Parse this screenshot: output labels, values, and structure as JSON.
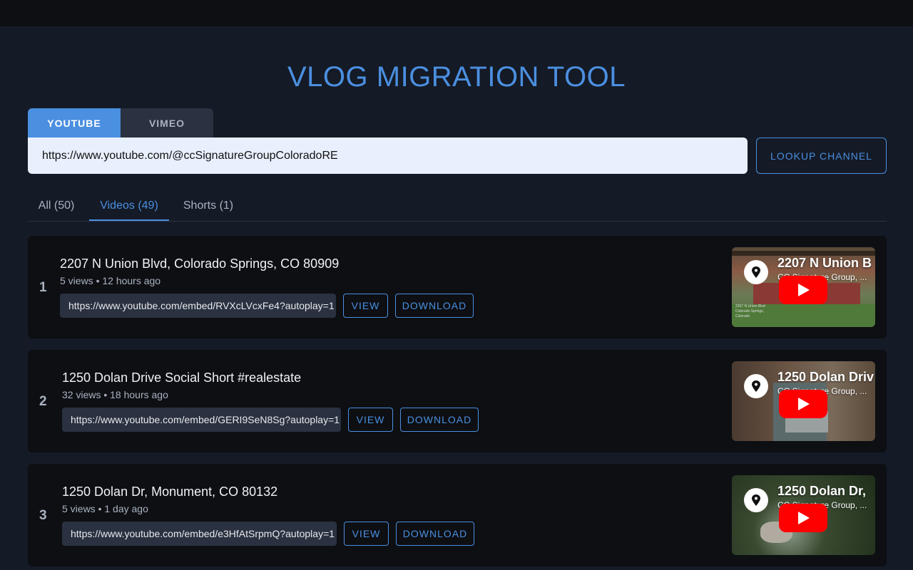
{
  "page": {
    "title": "VLOG MIGRATION TOOL"
  },
  "source_tabs": [
    {
      "label": "YOUTUBE",
      "active": true
    },
    {
      "label": "VIMEO",
      "active": false
    }
  ],
  "channel_input": {
    "value": "https://www.youtube.com/@ccSignatureGroupColoradoRE"
  },
  "lookup_button": {
    "label": "LOOKUP CHANNEL"
  },
  "filter_tabs": [
    {
      "label": "All (50)",
      "active": false
    },
    {
      "label": "Videos (49)",
      "active": true
    },
    {
      "label": "Shorts (1)",
      "active": false
    }
  ],
  "videos": [
    {
      "index": "1",
      "title": "2207 N Union Blvd, Colorado Springs, CO 80909",
      "meta": "5 views • 12 hours ago",
      "embed_url": "https://www.youtube.com/embed/RVXcLVcxFe4?autoplay=1",
      "view_label": "VIEW",
      "download_label": "DOWNLOAD",
      "thumb_title": "2207 N Union B",
      "thumb_channel": "CC Signature Group, ...",
      "thumb_caption": "2207 N Union Blvd Colorado Springs, Colorado"
    },
    {
      "index": "2",
      "title": "1250 Dolan Drive Social Short #realestate",
      "meta": "32 views • 18 hours ago",
      "embed_url": "https://www.youtube.com/embed/GERI9SeN8Sg?autoplay=1",
      "view_label": "VIEW",
      "download_label": "DOWNLOAD",
      "thumb_title": "1250 Dolan Driv",
      "thumb_channel": "CC Signature Group, ..."
    },
    {
      "index": "3",
      "title": "1250 Dolan Dr, Monument, CO 80132",
      "meta": "5 views • 1 day ago",
      "embed_url": "https://www.youtube.com/embed/e3HfAtSrpmQ?autoplay=1",
      "view_label": "VIEW",
      "download_label": "DOWNLOAD",
      "thumb_title": "1250 Dolan Dr,",
      "thumb_channel": "CC Signature Group, ..."
    }
  ],
  "colors": {
    "accent": "#4b8fe0",
    "background": "#141a26",
    "card": "#0d0f13",
    "play": "#ff0000"
  }
}
